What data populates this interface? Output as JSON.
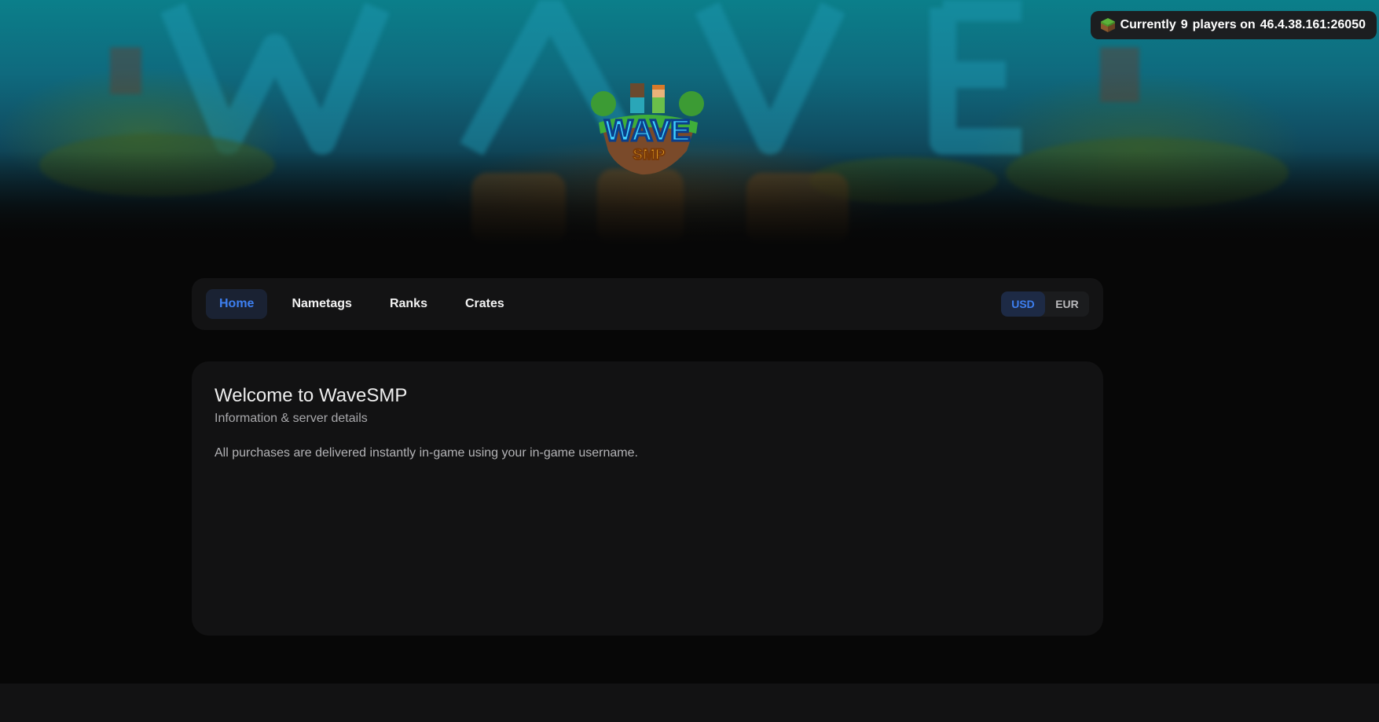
{
  "status": {
    "icon": "grass-block-icon",
    "prefix": "Currently",
    "count": "9",
    "mid": "players on",
    "address": "46.4.38.161:26050"
  },
  "logo": {
    "line1": "WAVE",
    "line2": "SMP"
  },
  "nav": {
    "items": [
      {
        "label": "Home",
        "active": true
      },
      {
        "label": "Nametags",
        "active": false
      },
      {
        "label": "Ranks",
        "active": false
      },
      {
        "label": "Crates",
        "active": false
      }
    ],
    "currency": [
      {
        "label": "USD",
        "active": true
      },
      {
        "label": "EUR",
        "active": false
      }
    ]
  },
  "card": {
    "title": "Welcome to WaveSMP",
    "subtitle": "Information & server details",
    "text": "All purchases are delivered instantly in-game using your in-game username."
  },
  "colors": {
    "accent": "#3d7ff0",
    "background": "#070707",
    "panel": "#131314"
  }
}
